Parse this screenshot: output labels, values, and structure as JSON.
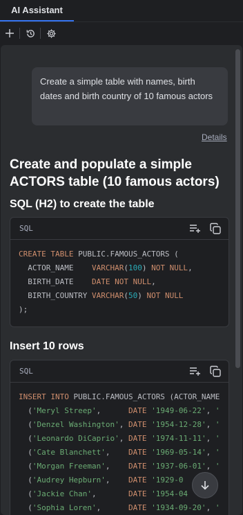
{
  "tabbar": {
    "active_tab": "AI Assistant"
  },
  "toolbar": {
    "buttons": [
      {
        "icon": "plus-icon"
      },
      {
        "icon": "history-icon"
      },
      {
        "icon": "gear-icon"
      }
    ]
  },
  "chat": {
    "user_message": "Create a simple table with names, birth dates and birth country of 10 famous actors",
    "details_link": "Details",
    "response_title": "Create and populate a simple ACTORS table (10 famous actors)",
    "section_create_title": "SQL (H2) to create the table",
    "section_insert_title": "Insert 10 rows",
    "create_block": {
      "language": "SQL",
      "lines": [
        "CREATE TABLE PUBLIC.FAMOUS_ACTORS (",
        "  ACTOR_NAME    VARCHAR(100) NOT NULL,",
        "  BIRTH_DATE    DATE NOT NULL,",
        "  BIRTH_COUNTRY VARCHAR(50) NOT NULL",
        ");"
      ]
    },
    "insert_block": {
      "language": "SQL",
      "lines": [
        "INSERT INTO PUBLIC.FAMOUS_ACTORS (ACTOR_NAME",
        "  ('Meryl Streep',      DATE '1949-06-22', '",
        "  ('Denzel Washington', DATE '1954-12-28', '",
        "  ('Leonardo DiCaprio', DATE '1974-11-11', '",
        "  ('Cate Blanchett',    DATE '1969-05-14', '",
        "  ('Morgan Freeman',    DATE '1937-06-01', '",
        "  ('Audrey Hepburn',    DATE '1929-0",
        "  ('Jackie Chan',       DATE '1954-04",
        "  ('Sophia Loren',      DATE '1934-09-20', '"
      ]
    },
    "code_actions": [
      "insert-at-caret-icon",
      "copy-icon"
    ],
    "scroll_down_icon": "arrow-down-icon"
  },
  "colors": {
    "accent": "#3574f0",
    "keyword": "#cf8e6d",
    "number": "#2aacb8",
    "string": "#6aab73"
  }
}
